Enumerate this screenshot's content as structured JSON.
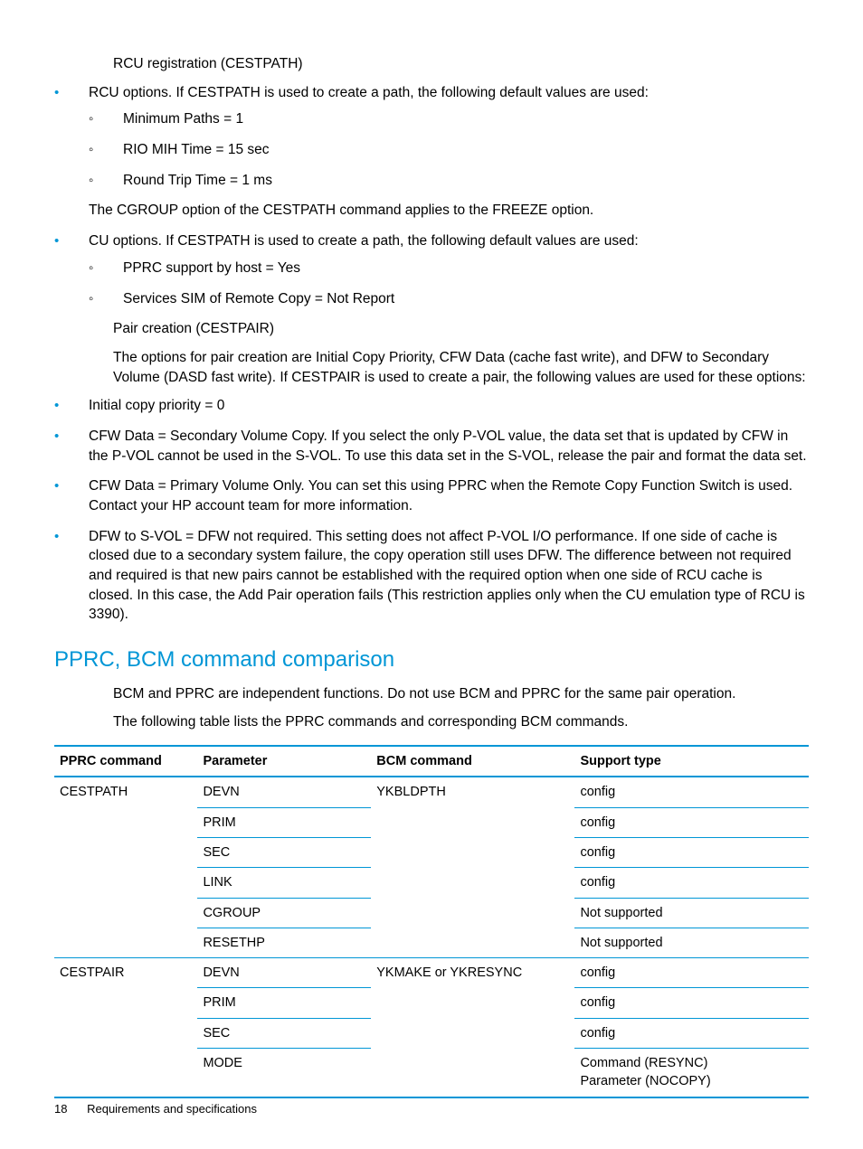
{
  "rcu_reg_title": "RCU registration (CESTPATH)",
  "bullet_rcu_options": "RCU options. If CESTPATH is used to create a path, the following default values are used:",
  "sub_min_paths": "Minimum Paths = 1",
  "sub_rio": "RIO MIH Time = 15 sec",
  "sub_rtt": "Round Trip Time = 1 ms",
  "cgroup_note": "The CGROUP option of the CESTPATH command applies to the FREEZE option.",
  "bullet_cu_options": "CU options. If CESTPATH is used to create a path, the following default values are used:",
  "sub_pprc_host": "PPRC support by host = Yes",
  "sub_services_sim": "Services SIM of Remote Copy = Not Report",
  "pair_creation_title": "Pair creation (CESTPAIR)",
  "pair_creation_intro": "The options for pair creation are Initial Copy Priority, CFW Data (cache fast write), and DFW to Secondary Volume (DASD fast write). If CESTPAIR is used to create a pair, the following values are used for these options:",
  "bullet_icp": "Initial copy priority = 0",
  "bullet_cfw_svc": "CFW Data = Secondary Volume Copy. If you select the only P-VOL value, the data set that is updated by CFW in the P-VOL cannot be used in the S-VOL. To use this data set in the S-VOL, release the pair and format the data set.",
  "bullet_cfw_pvo": "CFW Data = Primary Volume Only. You can set this using PPRC when the Remote Copy Function Switch is used. Contact your HP account team for more information.",
  "bullet_dfw": "DFW to S-VOL = DFW not required. This setting does not affect P-VOL I/O performance. If one side of cache is closed due to a secondary system failure, the copy operation still uses DFW. The difference between not required and required is that new pairs cannot be established with the required option when one side of RCU cache is closed. In this case, the Add Pair operation fails (This restriction applies only when the CU emulation type of RCU is 3390).",
  "heading_pprc_bcm": "PPRC, BCM command comparison",
  "pprc_bcm_p1": "BCM and PPRC are independent functions. Do not use BCM and PPRC for the same pair operation.",
  "pprc_bcm_p2": "The following table lists the PPRC commands and corresponding BCM commands.",
  "table": {
    "headers": {
      "c1": "PPRC command",
      "c2": "Parameter",
      "c3": "BCM command",
      "c4": "Support type"
    },
    "group1": {
      "cmd": "CESTPATH",
      "bcm": "YKBLDPTH",
      "rows": [
        {
          "param": "DEVN",
          "support": "config"
        },
        {
          "param": "PRIM",
          "support": "config"
        },
        {
          "param": "SEC",
          "support": "config"
        },
        {
          "param": "LINK",
          "support": "config"
        },
        {
          "param": "CGROUP",
          "support": "Not supported"
        },
        {
          "param": "RESETHP",
          "support": "Not supported"
        }
      ]
    },
    "group2": {
      "cmd": "CESTPAIR",
      "bcm": "YKMAKE or YKRESYNC",
      "rows": [
        {
          "param": "DEVN",
          "support": "config"
        },
        {
          "param": "PRIM",
          "support": "config"
        },
        {
          "param": "SEC",
          "support": "config"
        },
        {
          "param": "MODE",
          "support": "Command (RESYNC)\nParameter (NOCOPY)"
        }
      ]
    }
  },
  "footer_page": "18",
  "footer_text": "Requirements and specifications"
}
